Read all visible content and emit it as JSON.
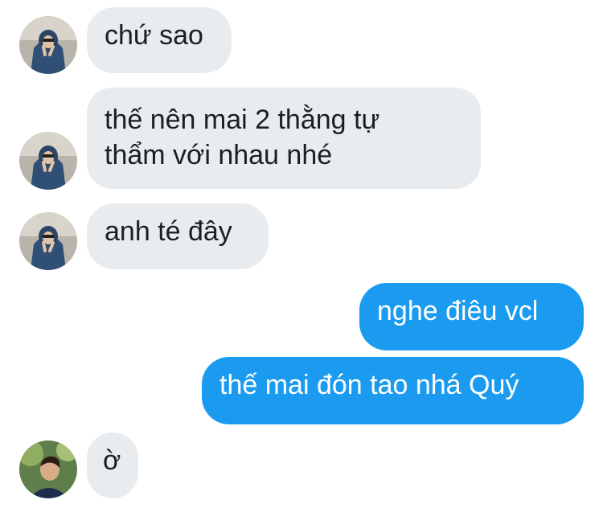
{
  "messages": [
    {
      "sender": "incoming",
      "text": "chứ sao"
    },
    {
      "sender": "incoming",
      "text": "thế nên mai 2 thằng tự\nthẩm với nhau nhé"
    },
    {
      "sender": "incoming",
      "text": "anh té đây"
    },
    {
      "sender": "outgoing",
      "text": "nghe điêu vcl"
    },
    {
      "sender": "outgoing",
      "text": "thế mai đón tao nhá Quý"
    },
    {
      "sender": "incoming",
      "text": "ờ"
    }
  ],
  "colors": {
    "incoming_bubble": "#e9ecef",
    "outgoing_bubble": "#1a9bf0",
    "incoming_text": "#1c1e21",
    "outgoing_text": "#ffffff"
  },
  "avatars": [
    {
      "icon": "person-hood-peace-sign-avatar"
    },
    {
      "icon": "person-hood-peace-sign-avatar"
    },
    {
      "icon": "person-hood-peace-sign-avatar"
    },
    {
      "icon": "person-outdoor-avatar"
    }
  ]
}
